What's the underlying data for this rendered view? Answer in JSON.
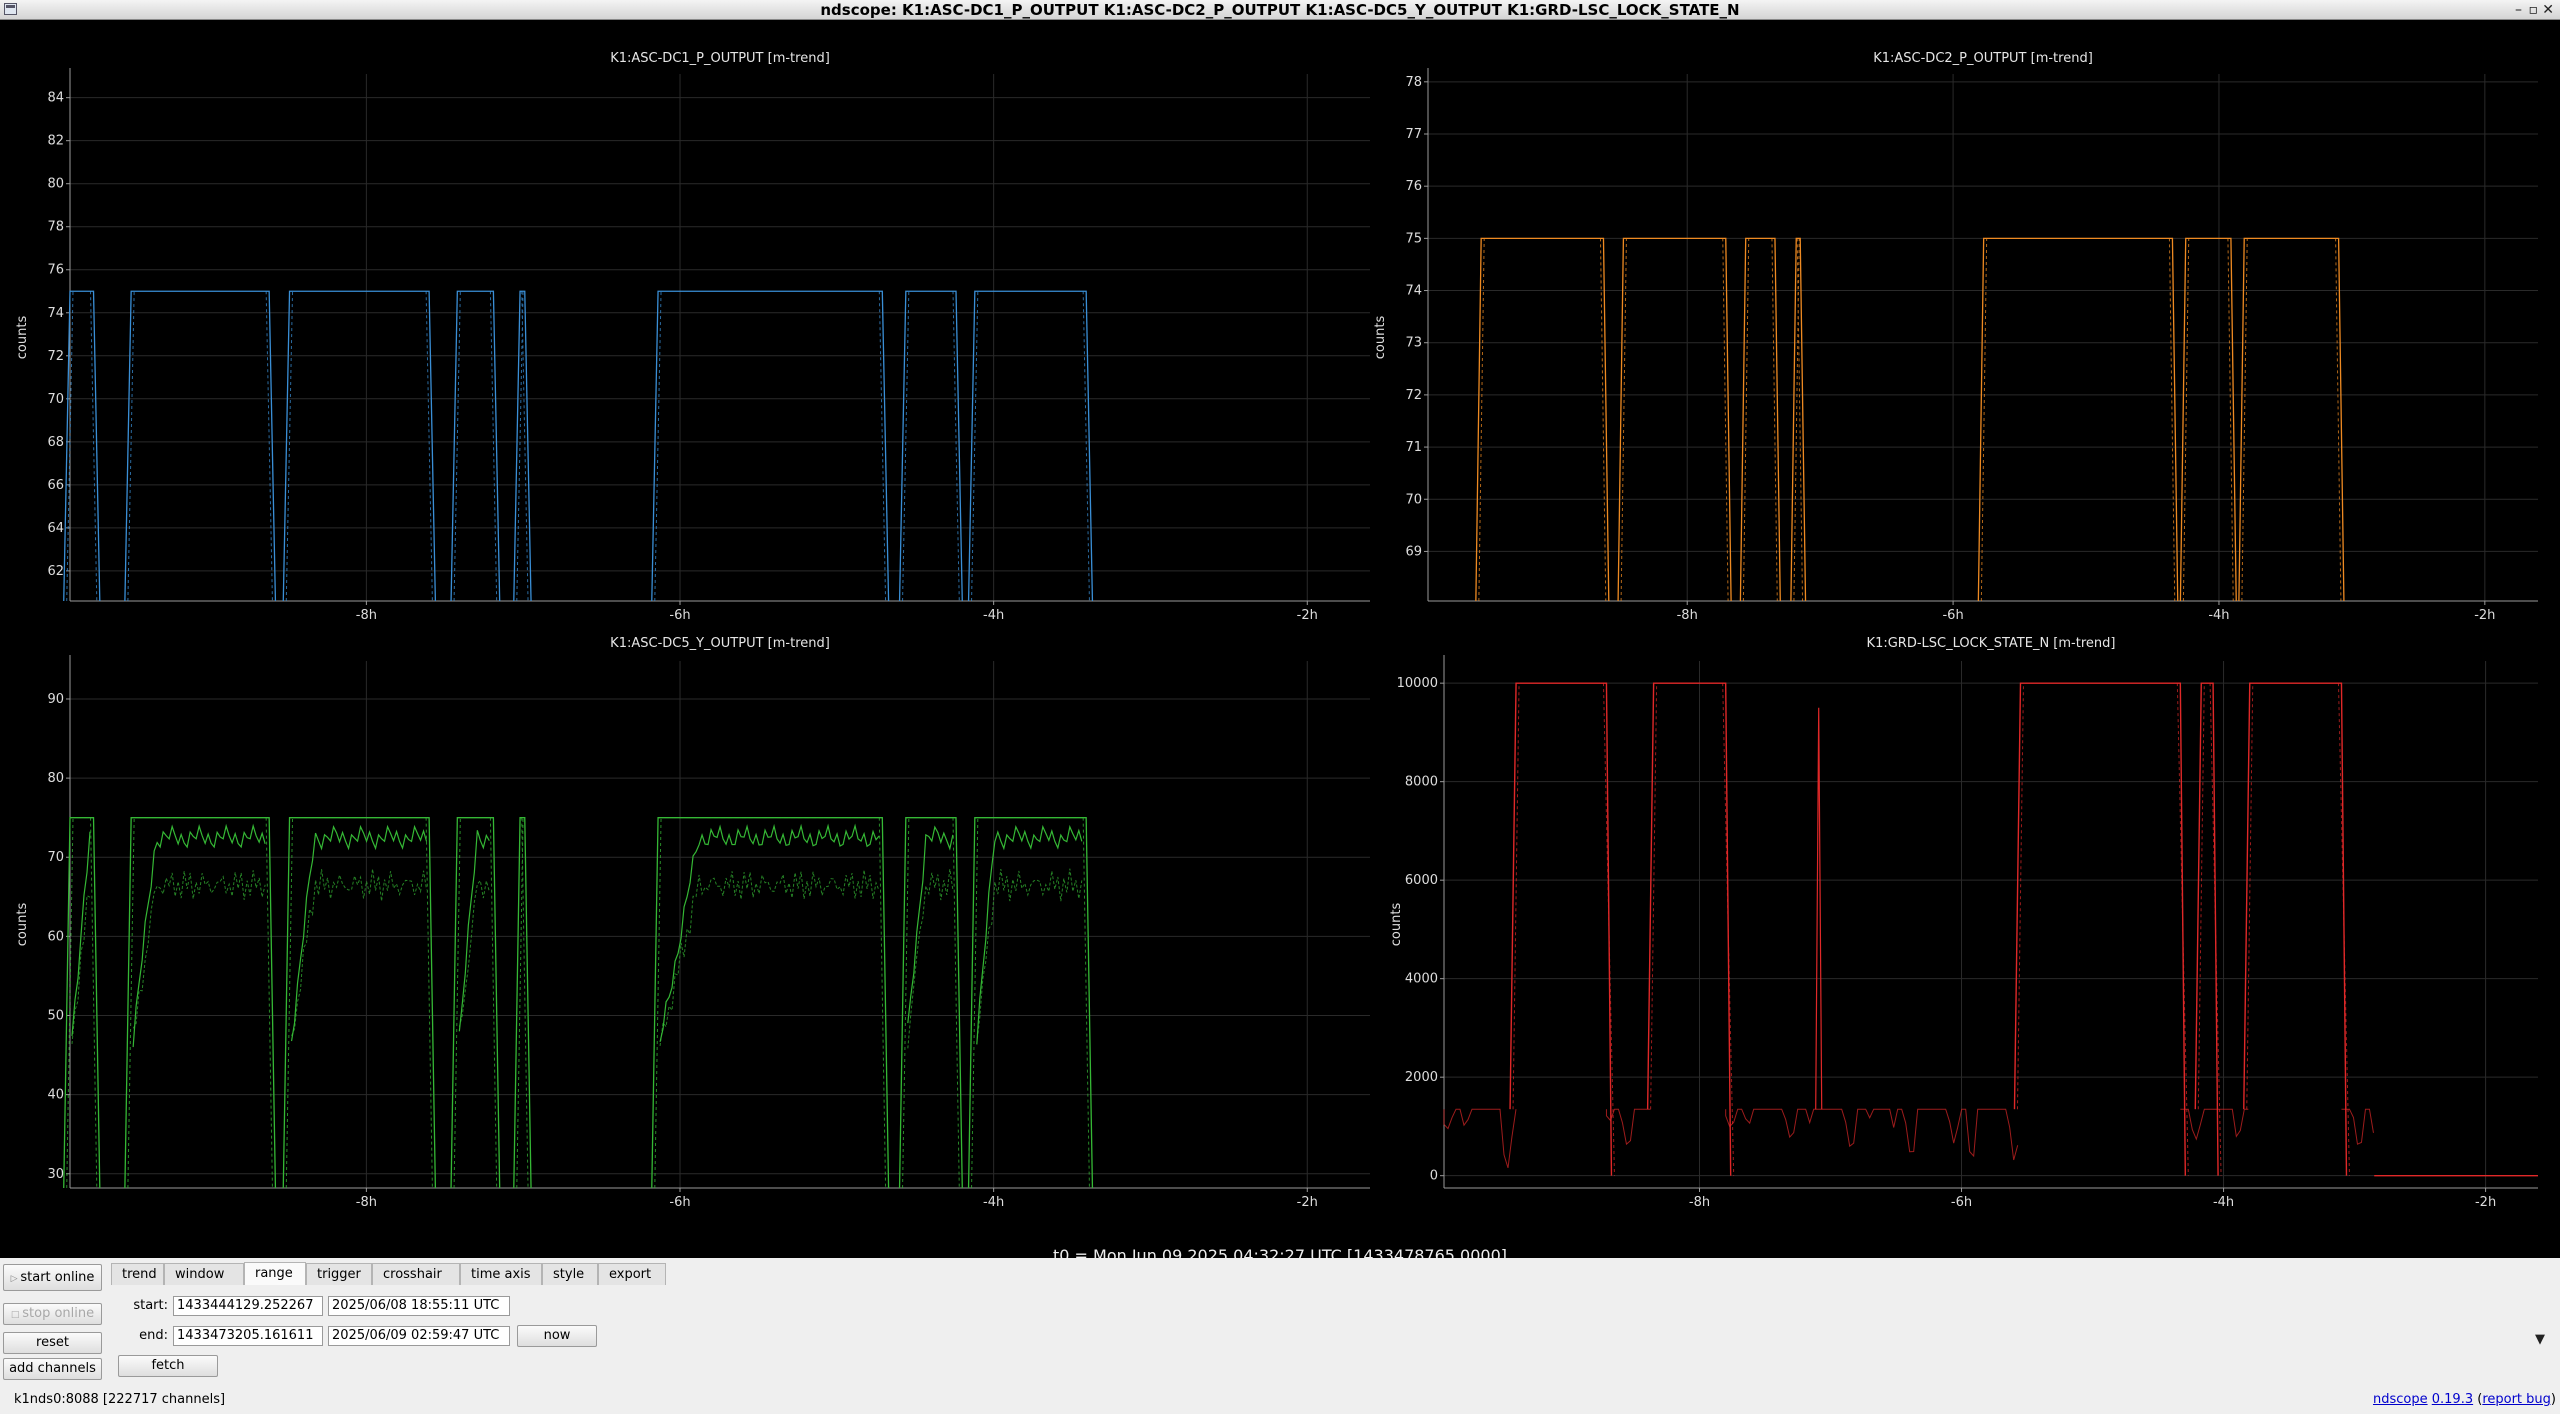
{
  "window": {
    "title": "ndscope: K1:ASC-DC1_P_OUTPUT K1:ASC-DC2_P_OUTPUT K1:ASC-DC5_Y_OUTPUT K1:GRD-LSC_LOCK_STATE_N",
    "controls": [
      "–",
      "▫",
      "✕"
    ]
  },
  "t0_label": "t0 = Mon Jun 09 2025 04:32:27 UTC [1433478765.0000]",
  "x_axis": {
    "unit": "h",
    "ticks": [
      -8,
      -6,
      -4,
      -2
    ],
    "tick_labels": [
      "-8h",
      "-6h",
      "-4h",
      "-2h"
    ]
  },
  "chart_data": [
    {
      "type": "line",
      "title": "K1:ASC-DC1_P_OUTPUT [m-trend]",
      "ylabel": "counts",
      "color": "#3a8fd6",
      "xlim": [
        -9.89,
        -1.6
      ],
      "ylim": [
        60.6,
        85.1
      ],
      "yticks": [
        62,
        64,
        66,
        68,
        70,
        72,
        74,
        76,
        78,
        80,
        82,
        84
      ],
      "high": 75,
      "low": 60.6,
      "segments": [
        [
          -9.89,
          -9.74
        ],
        [
          -9.5,
          -8.62
        ],
        [
          -8.49,
          -7.6
        ],
        [
          -7.42,
          -7.19
        ],
        [
          -7.02,
          -6.99
        ],
        [
          -6.14,
          -4.71
        ],
        [
          -4.56,
          -4.24
        ],
        [
          -4.12,
          -3.41
        ]
      ]
    },
    {
      "type": "line",
      "title": "K1:ASC-DC2_P_OUTPUT [m-trend]",
      "ylabel": "counts",
      "color": "#ee8a22",
      "xlim": [
        -9.95,
        -1.6
      ],
      "ylim": [
        68.05,
        78.15
      ],
      "yticks": [
        69,
        70,
        71,
        72,
        73,
        74,
        75,
        76,
        77,
        78
      ],
      "high": 75,
      "low": 68.05,
      "segments": [
        [
          -9.55,
          -8.63
        ],
        [
          -8.48,
          -7.71
        ],
        [
          -7.56,
          -7.34
        ],
        [
          -7.18,
          -7.15
        ],
        [
          -5.77,
          -4.35
        ],
        [
          -4.25,
          -3.91
        ],
        [
          -3.81,
          -3.1
        ]
      ]
    },
    {
      "type": "line",
      "title": "K1:ASC-DC5_Y_OUTPUT [m-trend]",
      "ylabel": "counts",
      "color": "#35b835",
      "xlim": [
        -9.89,
        -1.6
      ],
      "ylim": [
        28.2,
        94.8
      ],
      "yticks": [
        30,
        40,
        50,
        60,
        70,
        80,
        90
      ],
      "high": 75,
      "low": 28.2,
      "segments": [
        [
          -9.89,
          -9.74
        ],
        [
          -9.5,
          -8.62
        ],
        [
          -8.49,
          -7.6
        ],
        [
          -7.42,
          -7.19
        ],
        [
          -7.02,
          -6.99
        ],
        [
          -6.14,
          -4.71
        ],
        [
          -4.56,
          -4.24
        ],
        [
          -4.12,
          -3.41
        ]
      ]
    },
    {
      "type": "line",
      "title": "K1:GRD-LSC_LOCK_STATE_N [m-trend]",
      "ylabel": "counts",
      "color": "#e02828",
      "xlim": [
        -9.95,
        -1.6
      ],
      "ylim": [
        -250,
        10450
      ],
      "yticks": [
        0,
        2000,
        4000,
        6000,
        8000,
        10000
      ],
      "high": 10000,
      "mid": 1350,
      "low": 0,
      "segments": [
        [
          -9.4,
          -8.71
        ],
        [
          -8.35,
          -7.8
        ],
        [
          -5.55,
          -4.33
        ],
        [
          -4.17,
          -4.08
        ],
        [
          -3.8,
          -3.1
        ]
      ],
      "spikes": [
        -7.09
      ],
      "ripples": [
        [
          -9.95,
          -9.4
        ],
        [
          -8.71,
          -8.35
        ],
        [
          -7.8,
          -5.55
        ],
        [
          -4.33,
          -3.8
        ],
        [
          -3.1,
          -2.85
        ]
      ],
      "flat_after": -2.85
    }
  ],
  "control_panel": {
    "buttons": {
      "start_online": "start online",
      "stop_online": "stop online",
      "reset": "reset",
      "add_channels": "add channels",
      "fetch": "fetch",
      "now": "now"
    },
    "tabs": [
      "trend",
      "window",
      "range",
      "trigger",
      "crosshair",
      "time axis",
      "style",
      "export"
    ],
    "active_tab": "range",
    "range": {
      "start_label": "start:",
      "start_gps": "1433444129.252267",
      "start_utc": "2025/06/08 18:55:11 UTC",
      "end_label": "end:",
      "end_gps": "1433473205.161611",
      "end_utc": "2025/06/09 02:59:47 UTC"
    },
    "collapse_icon": "triangle-down-icon"
  },
  "status": {
    "server": "k1nds0:8088 [222717 channels]",
    "app_link": "ndscope",
    "version_link": "0.19.3",
    "report_bug": "report bug"
  }
}
